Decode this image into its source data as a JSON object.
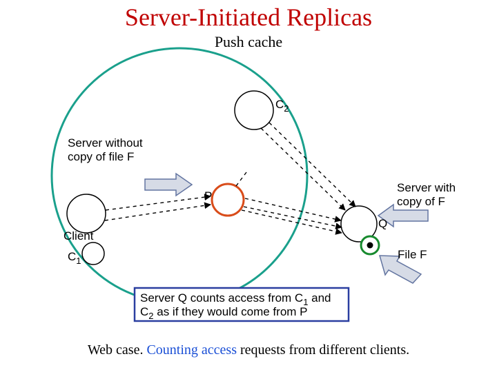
{
  "title": "Server-Initiated Replicas",
  "subtitle": "Push cache",
  "labels": {
    "c2": "C",
    "c2_sub": "2",
    "server_nocopy_l1": "Server without",
    "server_nocopy_l2": "copy of file F",
    "client": "Client",
    "c1": "C",
    "c1_sub": "1",
    "p": "P",
    "q": "Q",
    "server_copy_l1": "Server with",
    "server_copy_l2": "copy of F",
    "file_f": "File F",
    "box_l1a": "Server Q counts access from C",
    "box_l1b": " and",
    "box_l1_sub": "1",
    "box_l2a": "C",
    "box_l2_sub": "2",
    "box_l2b": "  as if they would come from P"
  },
  "footer_pre": "Web case. ",
  "footer_blue": "Counting access",
  "footer_post": " requests from different clients."
}
